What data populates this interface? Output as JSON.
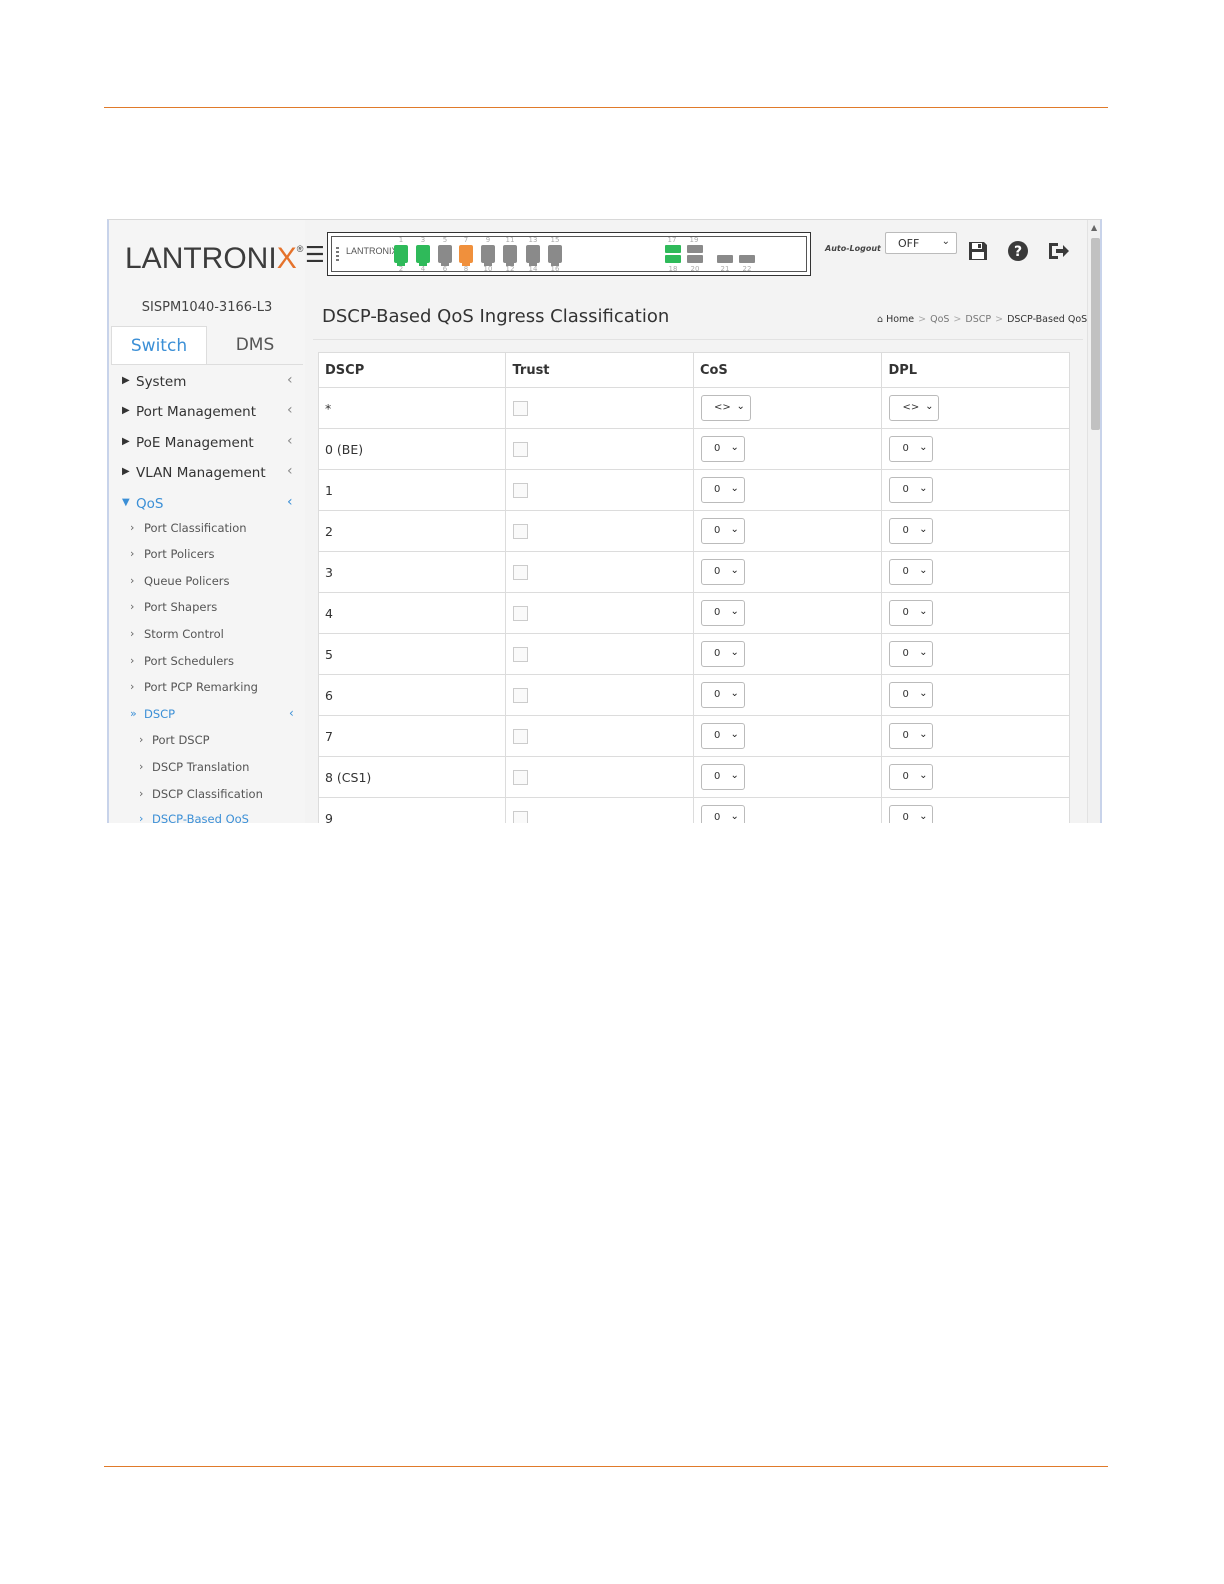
{
  "brand": {
    "logo_main": "LANTRONI",
    "logo_x": "X",
    "logo_reg": "®",
    "device": "SISPM1040-3166-L3"
  },
  "sidebar": {
    "tabs": [
      {
        "label": "Switch",
        "active": true
      },
      {
        "label": "DMS",
        "active": false
      }
    ],
    "menu": [
      {
        "label": "System"
      },
      {
        "label": "Port Management"
      },
      {
        "label": "PoE Management"
      },
      {
        "label": "VLAN Management"
      },
      {
        "label": "QoS"
      }
    ],
    "qos_sub": [
      {
        "label": "Port Classification"
      },
      {
        "label": "Port Policers"
      },
      {
        "label": "Queue Policers"
      },
      {
        "label": "Port Shapers"
      },
      {
        "label": "Storm Control"
      },
      {
        "label": "Port Schedulers"
      },
      {
        "label": "Port PCP Remarking"
      },
      {
        "label": "DSCP"
      }
    ],
    "dscp_sub": [
      {
        "label": "Port DSCP"
      },
      {
        "label": "DSCP Translation"
      },
      {
        "label": "DSCP Classification"
      },
      {
        "label": "DSCP-Based QoS"
      }
    ]
  },
  "header": {
    "panel_logo": "LANTRONIX",
    "top_ports": [
      "1",
      "3",
      "5",
      "7",
      "9",
      "11",
      "13",
      "15"
    ],
    "bottom_ports": [
      "2",
      "4",
      "6",
      "8",
      "10",
      "12",
      "14",
      "16"
    ],
    "sfp_top": [
      "17",
      "19"
    ],
    "sfp_bottom": [
      "18",
      "20",
      "21",
      "22"
    ],
    "auto_logout_label": "Auto-Logout",
    "auto_logout_value": "OFF"
  },
  "main": {
    "title": "DSCP-Based QoS Ingress Classification",
    "breadcrumb": [
      "Home",
      "QoS",
      "DSCP",
      "DSCP-Based QoS"
    ],
    "columns": [
      "DSCP",
      "Trust",
      "CoS",
      "DPL"
    ],
    "rows": [
      {
        "dscp": "*",
        "cos": "<>",
        "dpl": "<>"
      },
      {
        "dscp": "0 (BE)",
        "cos": "0",
        "dpl": "0"
      },
      {
        "dscp": "1",
        "cos": "0",
        "dpl": "0"
      },
      {
        "dscp": "2",
        "cos": "0",
        "dpl": "0"
      },
      {
        "dscp": "3",
        "cos": "0",
        "dpl": "0"
      },
      {
        "dscp": "4",
        "cos": "0",
        "dpl": "0"
      },
      {
        "dscp": "5",
        "cos": "0",
        "dpl": "0"
      },
      {
        "dscp": "6",
        "cos": "0",
        "dpl": "0"
      },
      {
        "dscp": "7",
        "cos": "0",
        "dpl": "0"
      },
      {
        "dscp": "8 (CS1)",
        "cos": "0",
        "dpl": "0"
      },
      {
        "dscp": "9",
        "cos": "0",
        "dpl": "0"
      }
    ]
  },
  "colors": {
    "accent": "#3b8fd6",
    "rule": "#e07a2a",
    "port_green": "#2fba5a",
    "port_orange": "#f0903c"
  }
}
